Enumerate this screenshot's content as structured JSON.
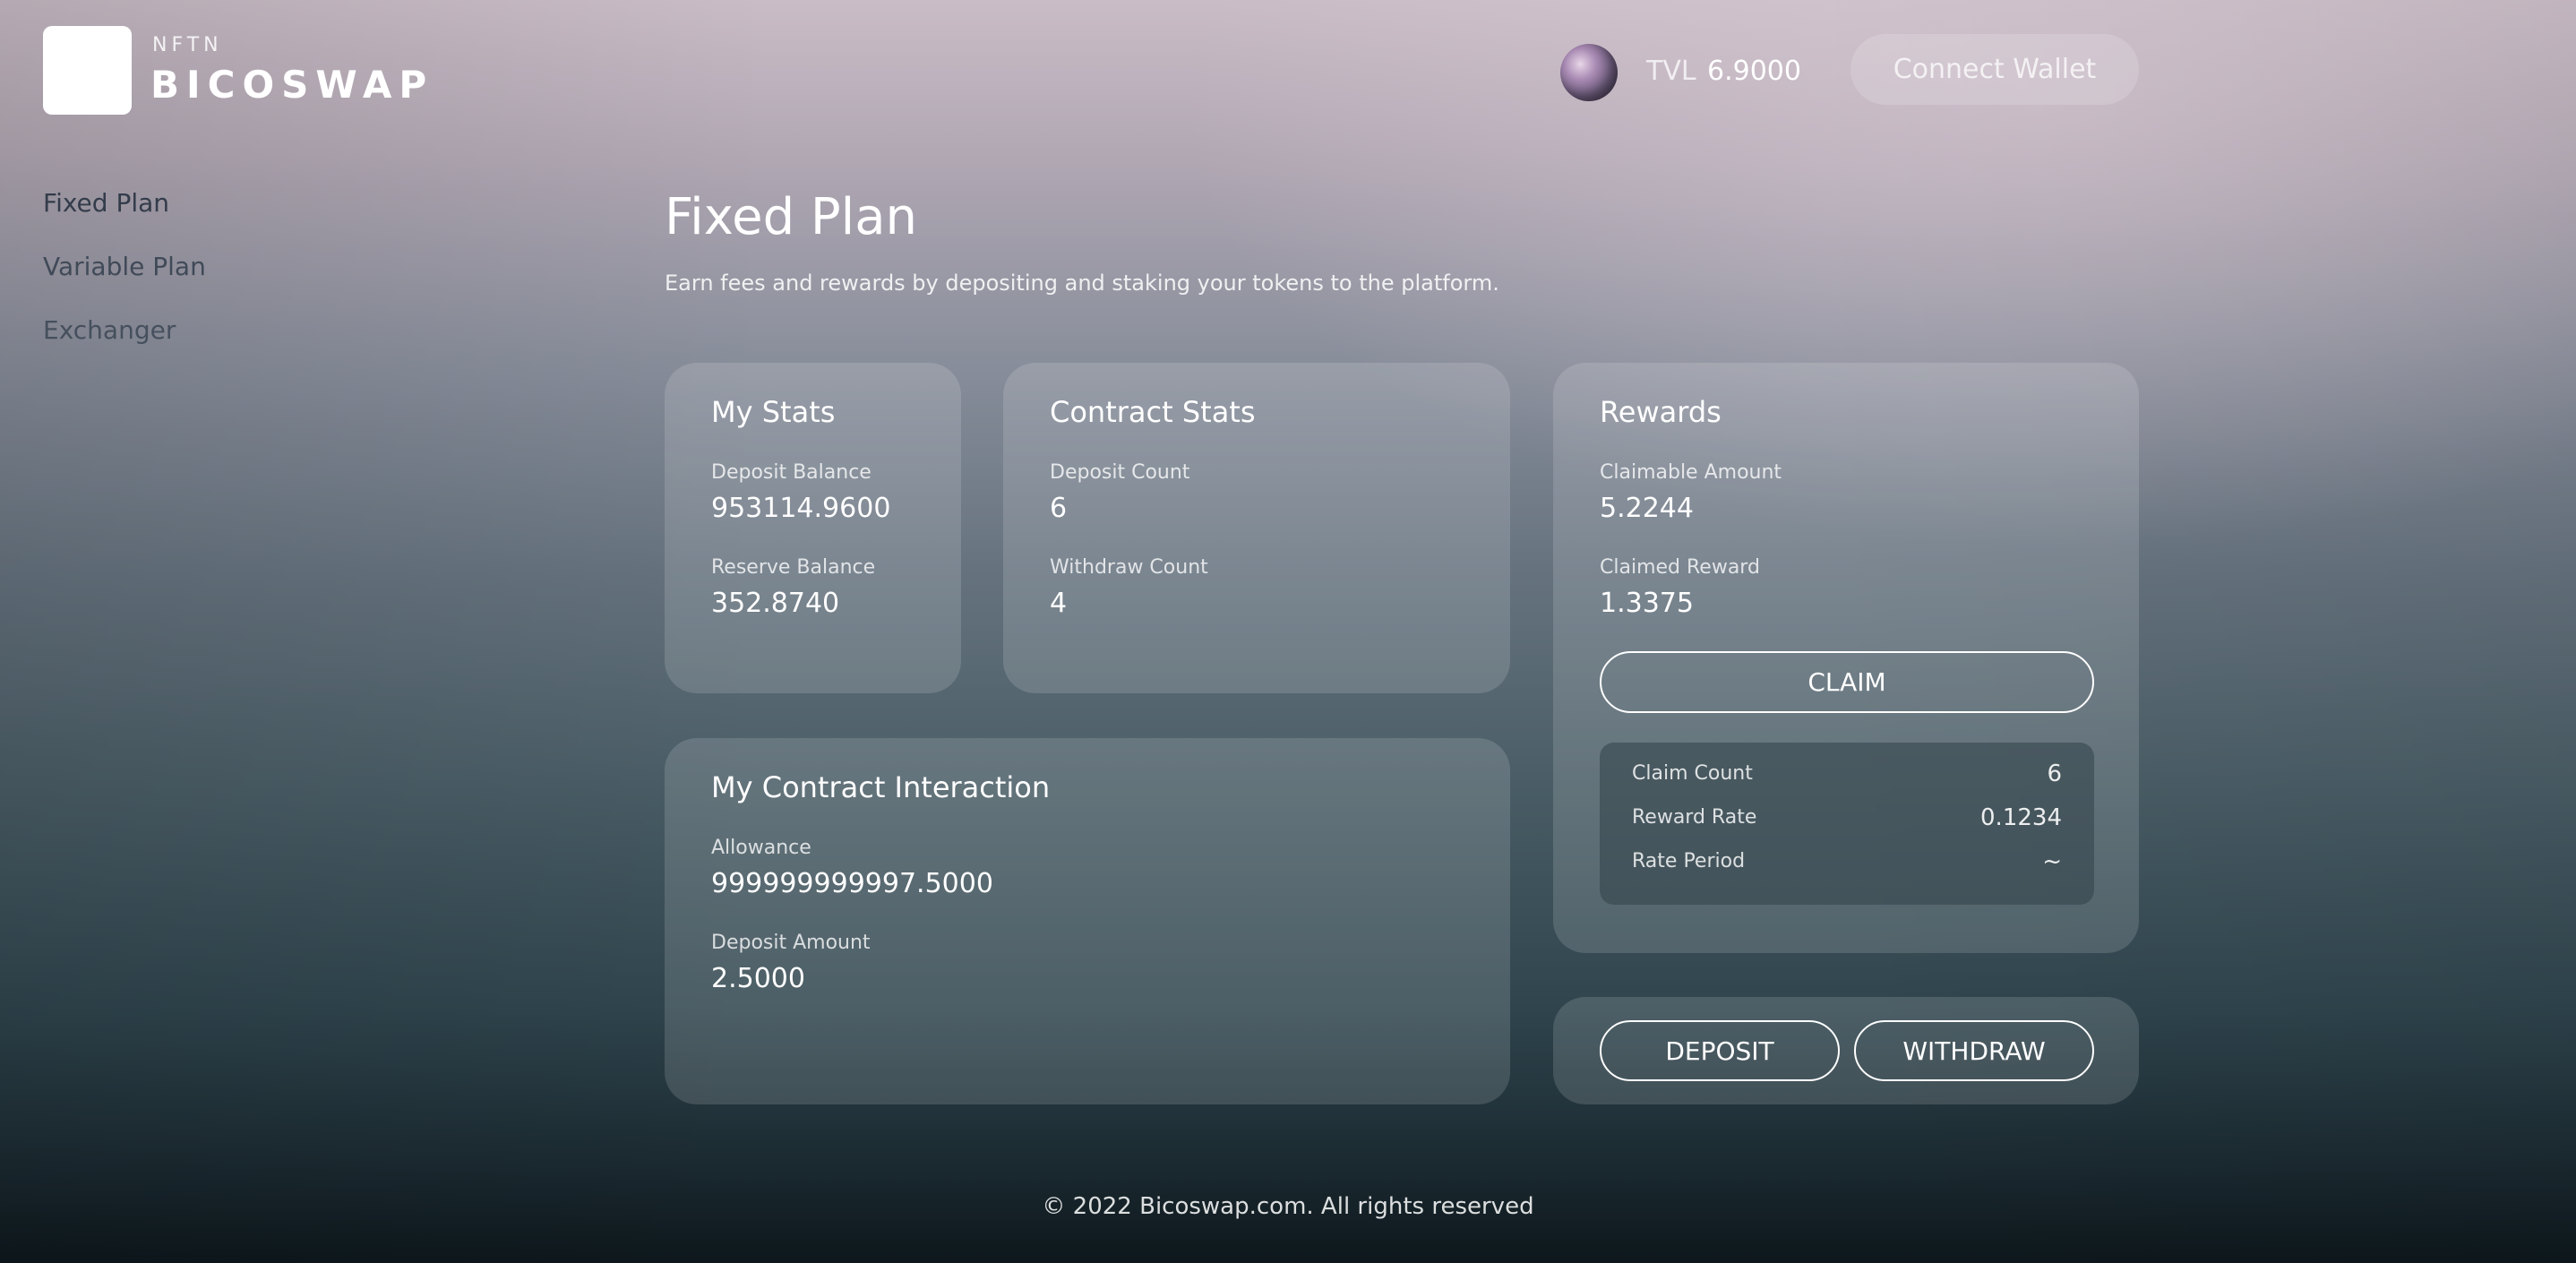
{
  "brand": {
    "small": "NFTN",
    "name": "BICOSWAP"
  },
  "header": {
    "tvl_label": "TVL",
    "tvl_value": "6.9000",
    "connect_label": "Connect Wallet"
  },
  "sidebar": {
    "items": [
      {
        "label": "Fixed Plan"
      },
      {
        "label": "Variable Plan"
      },
      {
        "label": "Exchanger"
      }
    ]
  },
  "main": {
    "title": "Fixed Plan",
    "subtitle": "Earn fees and rewards by depositing and staking your tokens to the platform."
  },
  "my_stats": {
    "title": "My Stats",
    "deposit_balance_label": "Deposit Balance",
    "deposit_balance_value": "953114.9600",
    "reserve_balance_label": "Reserve Balance",
    "reserve_balance_value": "352.8740"
  },
  "contract_stats": {
    "title": "Contract Stats",
    "deposit_count_label": "Deposit Count",
    "deposit_count_value": "6",
    "withdraw_count_label": "Withdraw Count",
    "withdraw_count_value": "4"
  },
  "interaction": {
    "title": "My Contract Interaction",
    "allowance_label": "Allowance",
    "allowance_value": "999999999997.5000",
    "deposit_amount_label": "Deposit Amount",
    "deposit_amount_value": "2.5000"
  },
  "rewards": {
    "title": "Rewards",
    "claimable_label": "Claimable Amount",
    "claimable_value": "5.2244",
    "claimed_label": "Claimed Reward",
    "claimed_value": "1.3375",
    "claim_button": "CLAIM",
    "details": [
      {
        "label": "Claim Count",
        "value": "6"
      },
      {
        "label": "Reward Rate",
        "value": "0.1234"
      },
      {
        "label": "Rate Period",
        "value": "~"
      }
    ]
  },
  "actions": {
    "deposit_button": "DEPOSIT",
    "withdraw_button": "WITHDRAW"
  },
  "footer": {
    "text": "© 2022 Bicoswap.com. All rights reserved"
  }
}
